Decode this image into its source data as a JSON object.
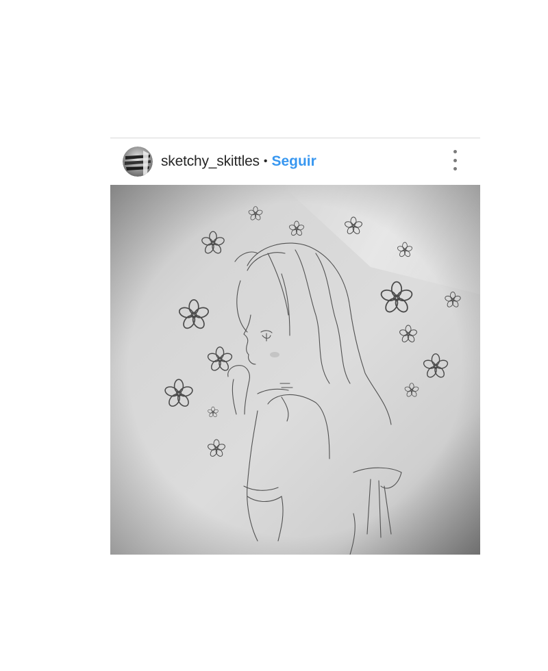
{
  "post": {
    "username": "sketchy_skittles",
    "separator": "•",
    "follow_label": "Seguir",
    "more_icon": "more-vertical-icon",
    "avatar_icon": "avatar-sketch",
    "image_subject": "pencil-sketch-girl-with-flowers"
  },
  "colors": {
    "accent": "#3897f0",
    "text": "#262626",
    "divider": "#d8d8d8"
  }
}
